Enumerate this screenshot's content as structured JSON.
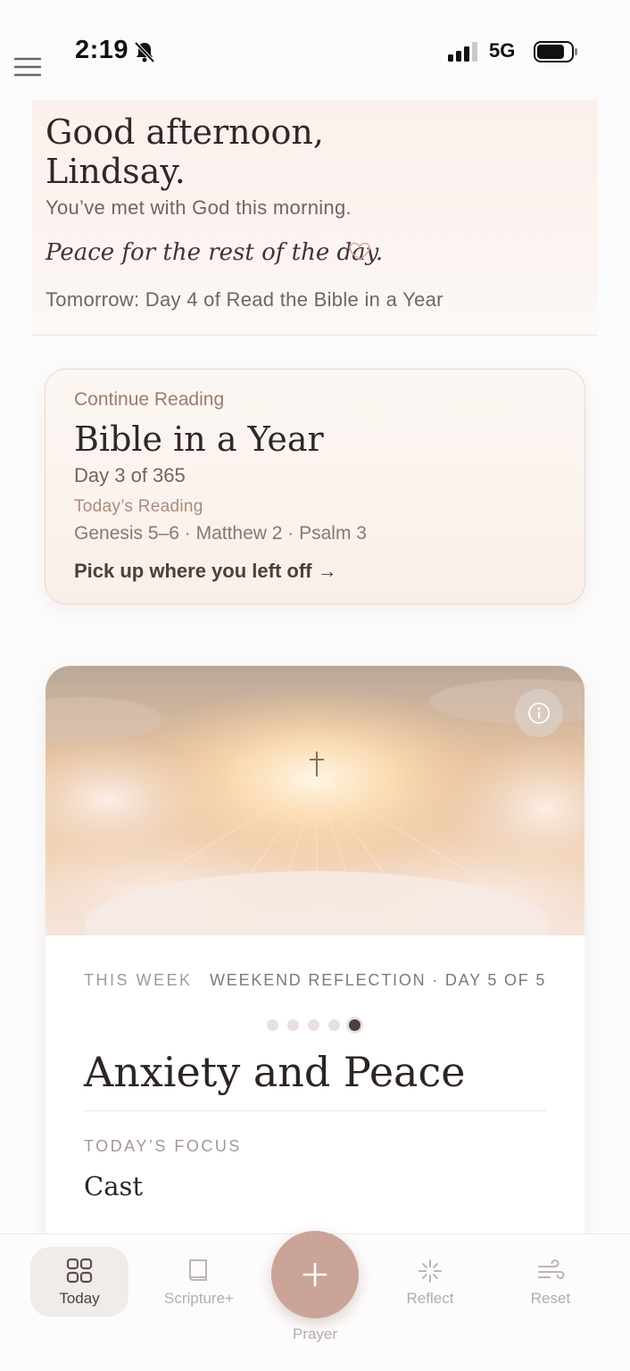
{
  "status_bar": {
    "time": "2:19",
    "network": "5G",
    "icons": [
      "bell-slash-icon",
      "signal-icon",
      "battery-icon"
    ]
  },
  "menu": {
    "icon": "hamburger-menu-icon"
  },
  "greeting": {
    "title": "Good afternoon,\nLindsay.",
    "subtitle": "You’ve met with God this morning.",
    "peace_line": "Peace for the rest of the day.",
    "tomorrow": "Tomorrow: Day 4 of Read the Bible in a Year"
  },
  "continue_reading": {
    "label": "Continue Reading",
    "title": "Bible in a Year",
    "day": "Day 3 of 365",
    "today_label": "Today’s Reading",
    "passages": "Genesis 5–6 · Matthew 2 · Psalm 3",
    "link": "Pick up where you left off →"
  },
  "weekly": {
    "label_week": "THIS WEEK",
    "label_series": "WEEKEND REFLECTION · DAY 5 OF 5",
    "page_count": 5,
    "active_page": 5,
    "title": "Anxiety and Peace",
    "focus_label": "TODAY’S FOCUS",
    "focus_word": "Cast"
  },
  "tabs": [
    {
      "label": "Today",
      "icon": "grid-icon",
      "active": true
    },
    {
      "label": "Scripture+",
      "icon": "book-icon",
      "active": false
    },
    {
      "label": "Prayer",
      "icon": "plus-icon",
      "active": false
    },
    {
      "label": "Reflect",
      "icon": "sparkle-icon",
      "active": false
    },
    {
      "label": "Reset",
      "icon": "wind-icon",
      "active": false
    }
  ],
  "colors": {
    "accent": "#c9a497",
    "card_border": "#ecd8cc",
    "text_dark": "#2f2825",
    "text_muted": "#6f6661"
  }
}
